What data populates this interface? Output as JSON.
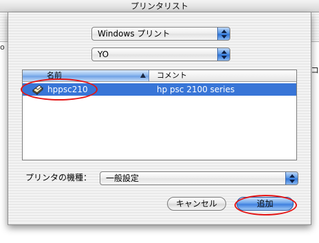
{
  "window": {
    "title": "プリンタリスト"
  },
  "background": {
    "left_edge_text": "o",
    "right_edge_text": "コ"
  },
  "dialog": {
    "protocol_popup": {
      "value": "Windows プリント"
    },
    "zone_popup": {
      "value": "YO"
    },
    "printer_list": {
      "columns": [
        "名前",
        "コメント"
      ],
      "sorted_column": "名前",
      "rows": [
        {
          "name": "hppsc210",
          "comment": "hp psc 2100 series",
          "icon": "printer-icon",
          "selected": true
        }
      ]
    },
    "model_label": "プリンタの機種：",
    "model_popup": {
      "value": "一般設定"
    },
    "buttons": {
      "cancel": "キャンセル",
      "add": "追加"
    }
  },
  "colors": {
    "selection": "#3875d7",
    "annotation": "#e41414"
  }
}
